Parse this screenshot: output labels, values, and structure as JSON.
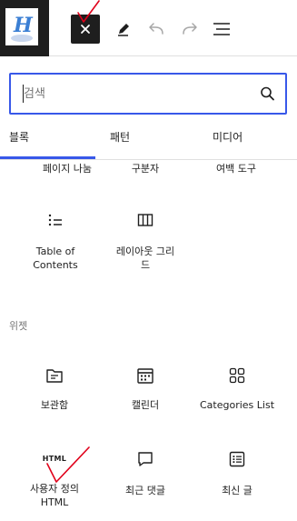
{
  "toolbar": {
    "logo_letter": "H",
    "icons": [
      "close-icon",
      "pencil-icon",
      "undo-icon",
      "redo-icon",
      "list-view-icon"
    ]
  },
  "search": {
    "placeholder": "검색"
  },
  "tabs": [
    {
      "label": "블록",
      "active": true
    },
    {
      "label": "패턴",
      "active": false
    },
    {
      "label": "미디어",
      "active": false
    }
  ],
  "design_blocks_partial": [
    {
      "label": "페이지 나눔"
    },
    {
      "label": "구분자"
    },
    {
      "label": "여백 도구"
    }
  ],
  "design_blocks": [
    {
      "label_line1": "Table of",
      "label_line2": "Contents",
      "icon": "table-of-contents-icon"
    },
    {
      "label_line1": "레이아웃 그리",
      "label_line2": "드",
      "icon": "layout-grid-icon"
    }
  ],
  "widgets": {
    "title": "위젯",
    "items": [
      {
        "label": "보관함",
        "icon": "archive-folder-icon"
      },
      {
        "label": "캘린더",
        "icon": "calendar-icon"
      },
      {
        "label": "Categories List",
        "icon": "categories-grid-icon"
      },
      {
        "label_line1": "사용자 정의",
        "label_line2": "HTML",
        "icon_text": "HTML",
        "icon": "html-icon"
      },
      {
        "label": "최근 댓글",
        "icon": "comment-icon"
      },
      {
        "label": "최신 글",
        "icon": "latest-posts-icon"
      }
    ]
  },
  "colors": {
    "accent": "#3858e9",
    "dark": "#1e1e1e",
    "annotation": "#e0001a"
  }
}
